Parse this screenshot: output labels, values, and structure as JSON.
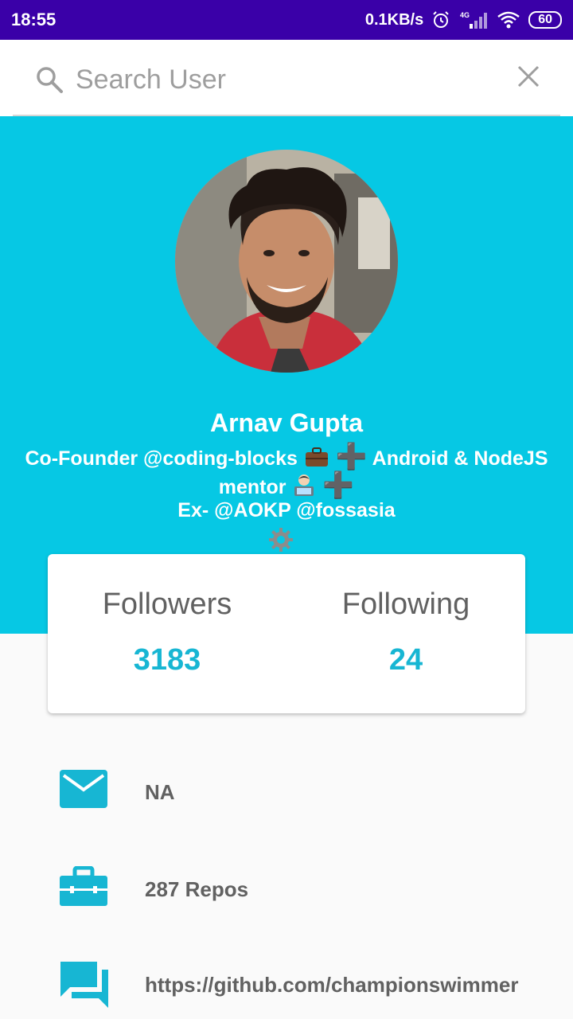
{
  "status_bar": {
    "time": "18:55",
    "network_speed": "0.1KB/s",
    "network_type": "4G",
    "battery": "60"
  },
  "search": {
    "placeholder": "Search User",
    "icon": "search-icon",
    "clear_icon": "close-icon"
  },
  "profile": {
    "name": "Arnav Gupta",
    "bio_line1_a": "Co-Founder @coding-blocks",
    "bio_line1_b": "Android & NodeJS",
    "bio_line2": "mentor",
    "bio_line3": "Ex- @AOKP @fossasia",
    "plus_glyph": "➕"
  },
  "stats": {
    "followers_label": "Followers",
    "followers_value": "3183",
    "following_label": "Following",
    "following_value": "24"
  },
  "info": {
    "email": "NA",
    "repos": "287 Repos",
    "url": "https://github.com/championswimmer"
  },
  "colors": {
    "status_bar": "#3a00a8",
    "header": "#06c8e4",
    "accent": "#17b6d3",
    "text_gray": "#616161"
  }
}
